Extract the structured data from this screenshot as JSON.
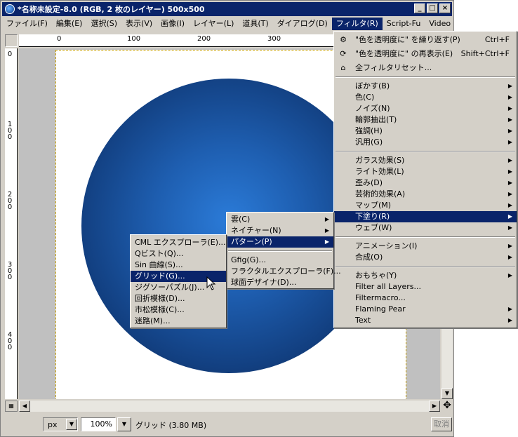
{
  "window": {
    "title": "*名称未設定-8.0 (RGB, 2 枚のレイヤー) 500x500",
    "minimize_label": "_",
    "maximize_label": "□",
    "close_label": "×"
  },
  "menubar": [
    {
      "label": "ファイル(F)"
    },
    {
      "label": "編集(E)"
    },
    {
      "label": "選択(S)"
    },
    {
      "label": "表示(V)"
    },
    {
      "label": "画像(I)"
    },
    {
      "label": "レイヤー(L)"
    },
    {
      "label": "道具(T)"
    },
    {
      "label": "ダイアログ(D)"
    },
    {
      "label": "フィルタ(R)"
    },
    {
      "label": "Script-Fu"
    },
    {
      "label": "Video"
    }
  ],
  "rulers": {
    "horizontal": [
      "0",
      "100",
      "200",
      "300"
    ],
    "vertical": [
      "0",
      "100",
      "200",
      "300",
      "400"
    ]
  },
  "status": {
    "unit": "px",
    "zoom": "100%",
    "text": "グリッド (3.80 MB)",
    "cancel_label": "取消"
  },
  "filter_menu": {
    "top_items": [
      {
        "label": "\"色を透明度に\" を繰り返す(P)",
        "shortcut": "Ctrl+F",
        "icon": "gear-icon"
      },
      {
        "label": "\"色を透明度に\" の再表示(E)",
        "shortcut": "Shift+Ctrl+F",
        "icon": "repeat-icon"
      },
      {
        "label": "全フィルタリセット...",
        "shortcut": "",
        "icon": "reset-icon"
      }
    ],
    "group1": [
      "ぼかす(B)",
      "色(C)",
      "ノイズ(N)",
      "輪郭抽出(T)",
      "強調(H)",
      "汎用(G)"
    ],
    "group2": [
      "ガラス効果(S)",
      "ライト効果(L)",
      "歪み(D)",
      "芸術的効果(A)",
      "マップ(M)",
      "下塗り(R)",
      "ウェブ(W)"
    ],
    "group3": [
      "アニメーション(I)",
      "合成(O)"
    ],
    "group4": [
      {
        "label": "おもちゃ(Y)",
        "arrow": true
      },
      {
        "label": "Filter all Layers...",
        "arrow": false
      },
      {
        "label": "Filtermacro...",
        "arrow": false
      },
      {
        "label": "Flaming Pear",
        "arrow": true
      },
      {
        "label": "Text",
        "arrow": true
      }
    ]
  },
  "render_menu": {
    "items": [
      "雲(C)",
      "ネイチャー(N)",
      "パターン(P)"
    ],
    "items2": [
      "Gfig(G)...",
      "フラクタルエクスプローラ(F)...",
      "球面デザイナ(D)..."
    ]
  },
  "pattern_menu": {
    "items": [
      "CML エクスプローラ(E)...",
      "Qビスト(Q)...",
      "Sin 曲線(S)...",
      "グリッド(G)...",
      "ジグソーパズル(J)...",
      "回折模様(D)...",
      "市松模様(C)...",
      "迷路(M)..."
    ]
  }
}
